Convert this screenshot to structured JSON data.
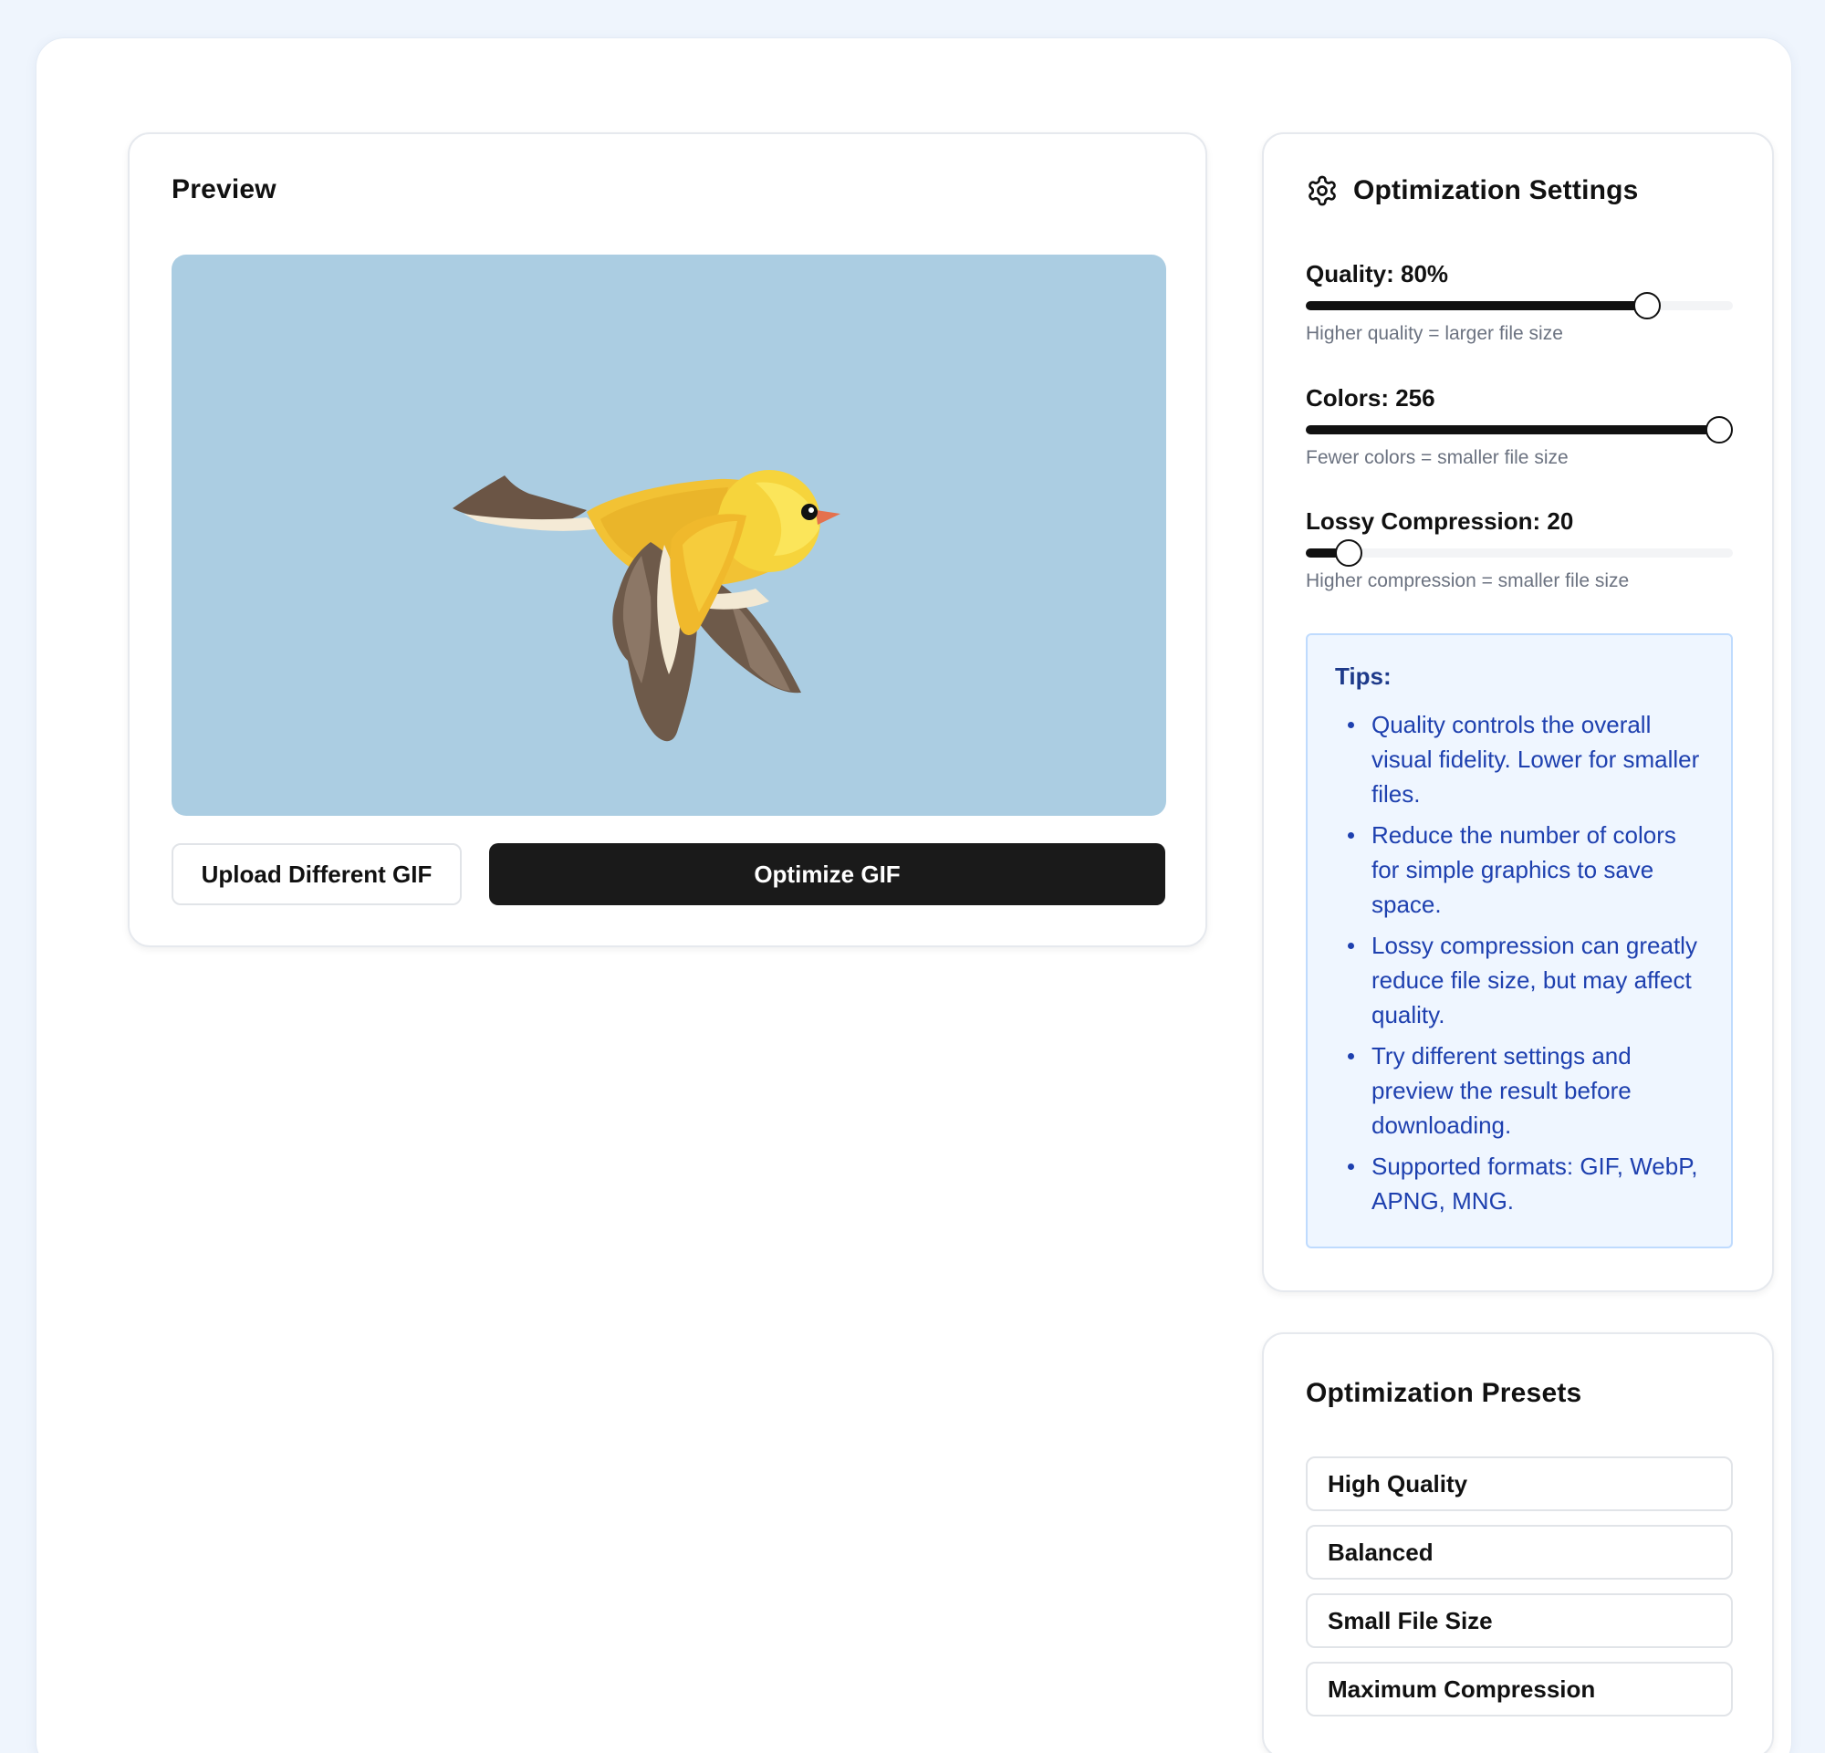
{
  "preview": {
    "title": "Preview",
    "image_alt": "yellow bird illustration",
    "image_bg": "#abcde2"
  },
  "actions": {
    "upload_label": "Upload Different GIF",
    "optimize_label": "Optimize GIF"
  },
  "settings": {
    "title": "Optimization Settings",
    "icon": "gear-icon",
    "quality": {
      "label": "Quality: 80%",
      "value": 80,
      "min": 0,
      "max": 100,
      "hint": "Higher quality = larger file size"
    },
    "colors": {
      "label": "Colors: 256",
      "value": 256,
      "min": 2,
      "max": 256,
      "hint": "Fewer colors = smaller file size"
    },
    "lossy": {
      "label": "Lossy Compression: 20",
      "value": 20,
      "min": 0,
      "max": 200,
      "hint": "Higher compression = smaller file size"
    }
  },
  "tips": {
    "title": "Tips:",
    "items": [
      "Quality controls the overall visual fidelity. Lower for smaller files.",
      "Reduce the number of colors for simple graphics to save space.",
      "Lossy compression can greatly reduce file size, but may affect quality.",
      "Try different settings and preview the result before downloading.",
      "Supported formats: GIF, WebP, APNG, MNG."
    ]
  },
  "presets": {
    "title": "Optimization Presets",
    "items": [
      "High Quality",
      "Balanced",
      "Small File Size",
      "Maximum Compression"
    ]
  },
  "colors_theme": {
    "page_bg": "#eff5fd",
    "primary_button": "#1a1a1a",
    "tips_bg": "#eff6ff",
    "tips_text": "#1e40af"
  }
}
